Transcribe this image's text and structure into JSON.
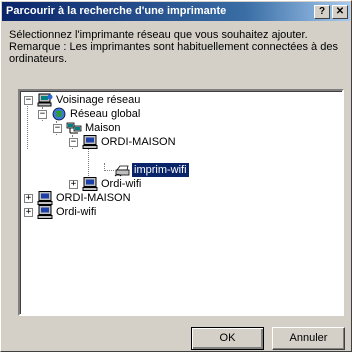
{
  "window": {
    "title": "Parcourir à la recherche d'une imprimante",
    "help_label": "?",
    "close_label": "✕"
  },
  "instructions": "Sélectionnez l'imprimante réseau que vous souhaitez ajouter. Remarque : Les imprimantes sont habituellement connectées à des ordinateurs.",
  "tree": {
    "root": {
      "label": "Voisinage réseau",
      "expander": "−"
    },
    "global": {
      "label": "Réseau global",
      "expander": "−"
    },
    "maison": {
      "label": "Maison",
      "expander": "−"
    },
    "ordi_maison_1": {
      "label": "ORDI-MAISON",
      "expander": "−"
    },
    "imprim": {
      "label": "imprim-wifi"
    },
    "ordi_wifi_1": {
      "label": "Ordi-wifi",
      "expander": "+"
    },
    "ordi_maison_2": {
      "label": "ORDI-MAISON",
      "expander": "+"
    },
    "ordi_wifi_2": {
      "label": "Ordi-wifi",
      "expander": "+"
    }
  },
  "buttons": {
    "ok": "OK",
    "cancel": "Annuler"
  },
  "colors": {
    "selection": "#0a246a",
    "title_start": "#0a246a",
    "title_end": "#a6caf0",
    "face": "#d4d0c8"
  },
  "icons": {
    "network": "network-neighborhood-icon",
    "globe": "globe-icon",
    "workgroup": "workgroup-icon",
    "computer": "computer-icon",
    "printer": "printer-icon"
  }
}
